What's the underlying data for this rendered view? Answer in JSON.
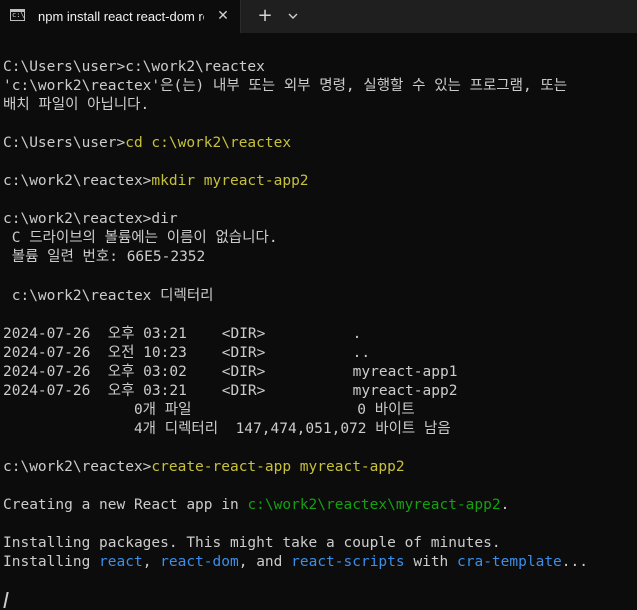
{
  "tab": {
    "title": "npm install react react-dom re",
    "icon": "terminal-icon",
    "close_glyph": "✕",
    "new_tab_glyph": "+",
    "dropdown_icon": "chevron-down-icon"
  },
  "colors": {
    "background": "#0c0c0c",
    "text": "#cccccc",
    "yellow": "#c7c13a",
    "green": "#13a10e",
    "blue": "#3b8eea"
  },
  "terminal": {
    "lines": [
      [
        {
          "text": "C:\\Users\\user>c:\\work2\\reactex",
          "color": "white"
        }
      ],
      [
        {
          "text": "'c:\\work2\\reactex'은(는) 내부 또는 외부 명령, 실행할 수 있는 프로그램, 또는",
          "color": "white"
        }
      ],
      [
        {
          "text": "배치 파일이 아닙니다.",
          "color": "white"
        }
      ],
      [
        {
          "text": "",
          "color": "white"
        }
      ],
      [
        {
          "text": "C:\\Users\\user>",
          "color": "white"
        },
        {
          "text": "cd c:\\work2\\reactex",
          "color": "yellow2"
        }
      ],
      [
        {
          "text": "",
          "color": "white"
        }
      ],
      [
        {
          "text": "c:\\work2\\reactex>",
          "color": "white"
        },
        {
          "text": "mkdir myreact-app2",
          "color": "yellow2"
        }
      ],
      [
        {
          "text": "",
          "color": "white"
        }
      ],
      [
        {
          "text": "c:\\work2\\reactex>dir",
          "color": "white"
        }
      ],
      [
        {
          "text": " C 드라이브의 볼륨에는 이름이 없습니다.",
          "color": "white"
        }
      ],
      [
        {
          "text": " 볼륨 일련 번호: 66E5-2352",
          "color": "white"
        }
      ],
      [
        {
          "text": "",
          "color": "white"
        }
      ],
      [
        {
          "text": " c:\\work2\\reactex 디렉터리",
          "color": "white"
        }
      ],
      [
        {
          "text": "",
          "color": "white"
        }
      ],
      [
        {
          "text": "2024-07-26  오후 03:21    <DIR>          .",
          "color": "white"
        }
      ],
      [
        {
          "text": "2024-07-26  오전 10:23    <DIR>          ..",
          "color": "white"
        }
      ],
      [
        {
          "text": "2024-07-26  오후 03:02    <DIR>          myreact-app1",
          "color": "white"
        }
      ],
      [
        {
          "text": "2024-07-26  오후 03:21    <DIR>          myreact-app2",
          "color": "white"
        }
      ],
      [
        {
          "text": "               0개 파일                   0 바이트",
          "color": "white"
        }
      ],
      [
        {
          "text": "               4개 디렉터리  147,474,051,072 바이트 남음",
          "color": "white"
        }
      ],
      [
        {
          "text": "",
          "color": "white"
        }
      ],
      [
        {
          "text": "c:\\work2\\reactex>",
          "color": "white"
        },
        {
          "text": "create-react-app myreact-app2",
          "color": "yellow2"
        }
      ],
      [
        {
          "text": "",
          "color": "white"
        }
      ],
      [
        {
          "text": "Creating a new React app in ",
          "color": "white"
        },
        {
          "text": "c:\\work2\\reactex\\myreact-app2",
          "color": "green"
        },
        {
          "text": ".",
          "color": "white"
        }
      ],
      [
        {
          "text": "",
          "color": "white"
        }
      ],
      [
        {
          "text": "Installing packages. This might take a couple of minutes.",
          "color": "white"
        }
      ],
      [
        {
          "text": "Installing ",
          "color": "white"
        },
        {
          "text": "react",
          "color": "blue"
        },
        {
          "text": ", ",
          "color": "white"
        },
        {
          "text": "react-dom",
          "color": "blue"
        },
        {
          "text": ", and ",
          "color": "white"
        },
        {
          "text": "react-scripts",
          "color": "blue"
        },
        {
          "text": " with ",
          "color": "white"
        },
        {
          "text": "cra-template",
          "color": "blue"
        },
        {
          "text": "...",
          "color": "white"
        }
      ]
    ]
  }
}
